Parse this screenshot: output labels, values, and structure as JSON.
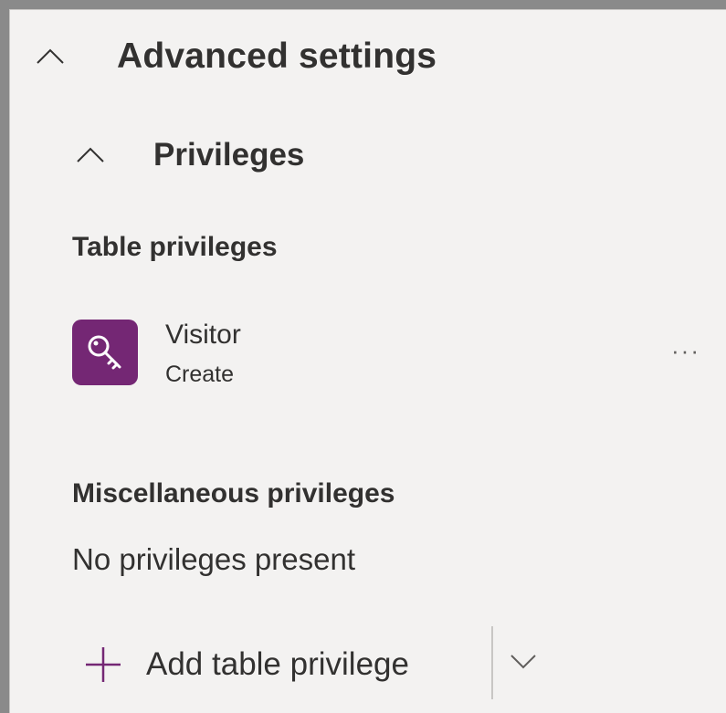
{
  "advanced_settings": {
    "title": "Advanced settings",
    "chevron_icon": "chevron-up-icon"
  },
  "privileges": {
    "title": "Privileges",
    "chevron_icon": "chevron-up-icon"
  },
  "table_privileges": {
    "heading": "Table privileges",
    "items": [
      {
        "name": "Visitor",
        "access": "Create",
        "icon": "key-icon",
        "icon_bg": "#742774",
        "more_label": "···"
      }
    ]
  },
  "misc_privileges": {
    "heading": "Miscellaneous privileges",
    "empty_text": "No privileges present"
  },
  "add_button": {
    "label": "Add table privilege",
    "icon": "plus-icon",
    "accent": "#742774",
    "dropdown_icon": "chevron-down-icon"
  }
}
